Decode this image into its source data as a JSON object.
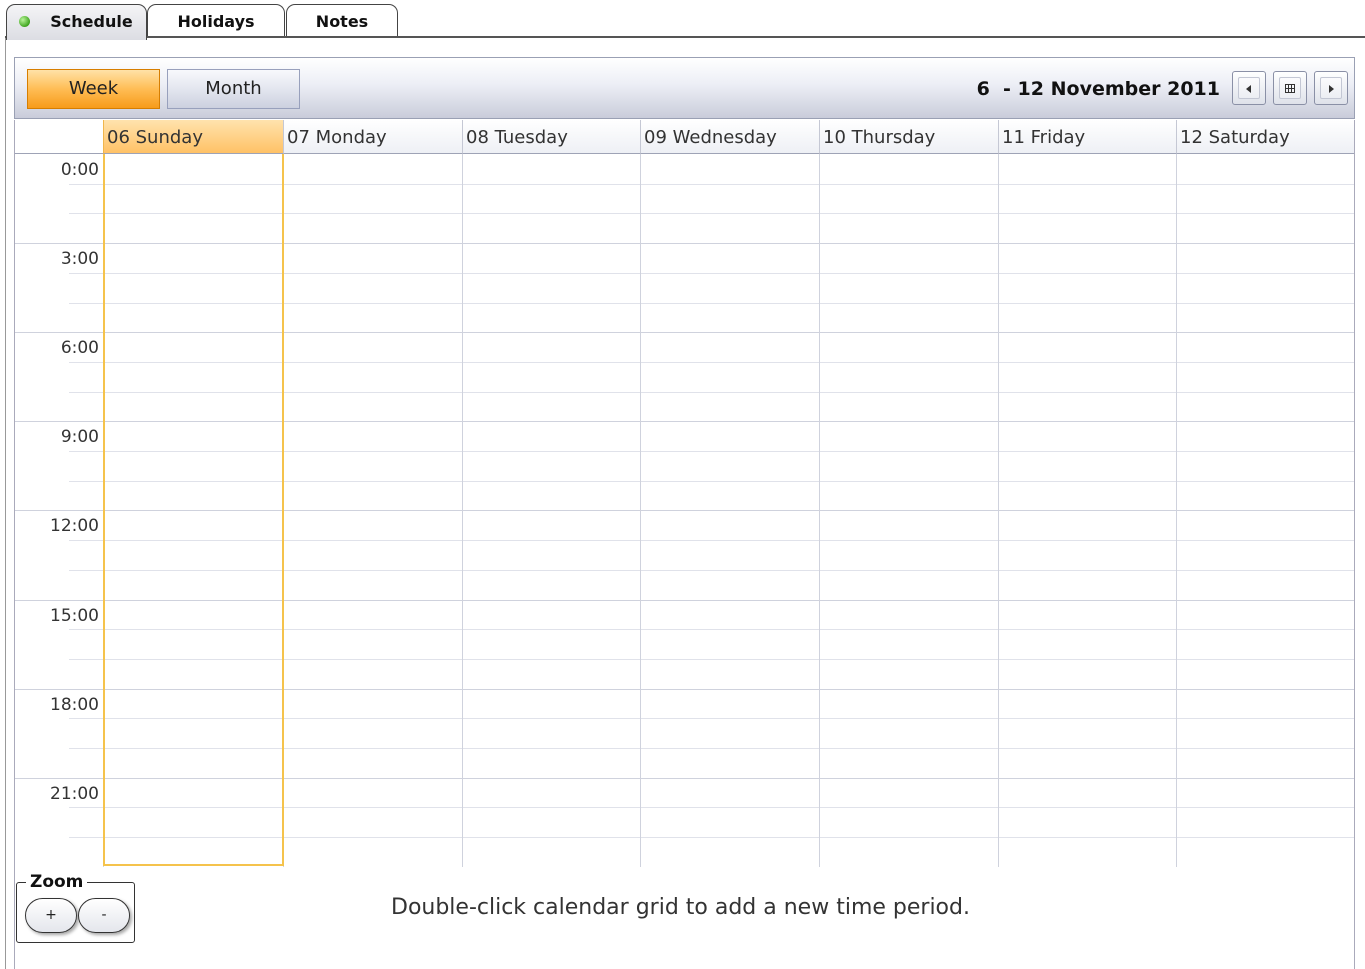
{
  "tabs": [
    {
      "label": "Schedule",
      "active": true
    },
    {
      "label": "Holidays",
      "active": false
    },
    {
      "label": "Notes",
      "active": false
    }
  ],
  "toolbar": {
    "week_label": "Week",
    "month_label": "Month",
    "date_range": "6  - 12 November 2011",
    "prev_icon": "chevron-left-icon",
    "today_icon": "calendar-grid-icon",
    "next_icon": "chevron-right-icon"
  },
  "calendar": {
    "days": [
      "06 Sunday",
      "07 Monday",
      "08 Tuesday",
      "09 Wednesday",
      "10 Thursday",
      "11 Friday",
      "12 Saturday"
    ],
    "selected_day": "06 Sunday",
    "time_labels": [
      "0:00",
      "3:00",
      "6:00",
      "9:00",
      "12:00",
      "15:00",
      "18:00",
      "21:00"
    ]
  },
  "zoom": {
    "label": "Zoom",
    "plus_label": "+",
    "minus_label": "-"
  },
  "hint": "Double-click calendar grid to add a new time period.",
  "colors": {
    "accent_orange": "#ffbd55",
    "today_border": "#f5c34c",
    "status_green": "#3fa51f"
  }
}
